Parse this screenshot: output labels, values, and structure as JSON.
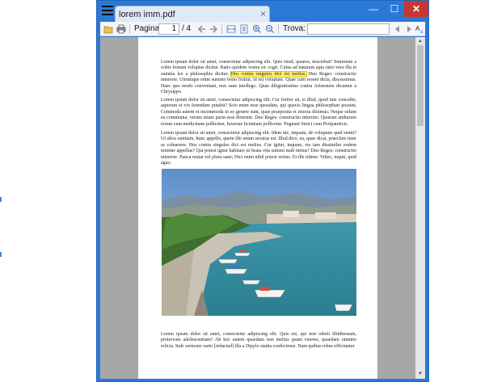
{
  "window": {
    "tab_title": "lorem imm.pdf",
    "close_tab_glyph": "×",
    "min_glyph": "—",
    "max_glyph": "☐",
    "close_glyph": "✕",
    "accent": "#2b79d6",
    "close_color": "#c7372f"
  },
  "toolbar": {
    "page_label": "Pagina:",
    "page_current": "1",
    "page_total": "/ 4",
    "search_label": "Trova:",
    "search_value": "",
    "icons": [
      "open-icon",
      "print-icon",
      "prev-page-icon",
      "next-page-icon",
      "fit-width-icon",
      "fit-page-icon",
      "zoom-in-icon",
      "zoom-out-icon",
      "find-prev-icon",
      "find-next-icon",
      "match-case-icon"
    ]
  },
  "document": {
    "para1_before": "Lorem ipsum dolor sit amet, consectetur adipiscing elit. Quis istud, quaeso, nesciebat? Summum a vobis bonum voluptas dicitur. Ratio quidem vestra sic cogit. Cuius ad naturam apta ratio vera illa et summa lex a philosophis dicitur.",
    "para1_highlight": "Hos contra singulos dici est melius.",
    "para1_after": " Duo Reges: constructio interrete. Utrumque enim summo bono fruitur, id est voluptate. Quae cum essent dicta, discessimus. Haec quo modo conveniant, non sane intellego. Quae diligentissime contra Aristonem dicuntur a Chrysippo.",
    "para2": "Lorem ipsum dolor sit amet, consectetur adipiscing elit. Cur fortior sit, si illud, quod tute concedis, asperum et vix ferendum putabit? Scio enim esse quosdam, qui quavis lingua philosophari possint; Commoda autem et incommoda in eo genere sunt, quae praeposita et reiecta diximus; Neque solum ea communia, verum etiam paria esse dixerunt. Duo Reges: constructio interrete. Quarum ambarum rerum cum medicinam pollicetur, luxuriae licentiam pollicetur. Pugnant Stoici cum Peripateticis.",
    "para3": "Lorem ipsum dolor sit amet, consectetur adipiscing elit. Idem nie, inquam, de voluptate quid sentit? Ut alios omittam, hunc appello, quem ille unum secutus est. Illud dico, ea, quae dicat, praeclare inter se cohaerere. Hos contra singulos dici est melius. Cur igitur, inquam, res tam dissimiles eodem nomine appellas? Qui potest igitur habitare in beata vita summi mali metus? Duo Reges: constructio interrete. Pauca mutat vel plura sane; Dici enim nihil potest verius. Et ille ridens: Video, inquit, quid agas;",
    "para4": "Lorem ipsum dolor sit amet, consectetur adipiscing elit. Quis est, qui non oderit libidinosam, protervam adolescentiam? Ab hoc autem quaedam non melius quam veteres, quaedam omnino relicta. Inde sermone vario [redacted] illa a Dipylo stadia confecimus. Nam quibus rebus efficiuntur"
  }
}
